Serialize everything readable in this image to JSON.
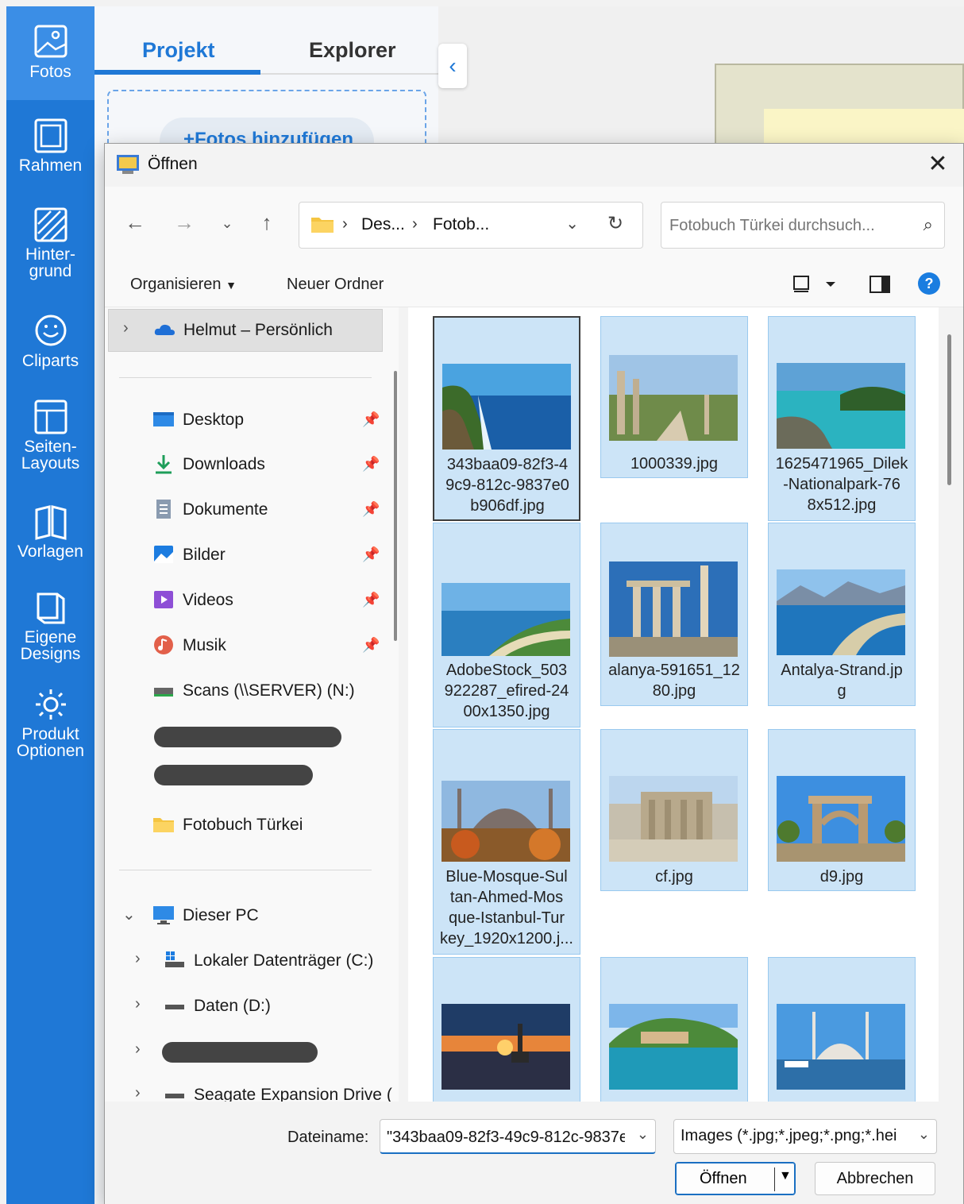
{
  "app": {
    "sidebar": {
      "items": [
        {
          "label": "Fotos",
          "icon": "photos-icon"
        },
        {
          "label": "Rahmen",
          "icon": "frame-icon"
        },
        {
          "label": "Hinter-",
          "label2": "grund",
          "icon": "background-icon"
        },
        {
          "label": "Cliparts",
          "icon": "clipart-icon"
        },
        {
          "label": "Seiten-",
          "label2": "Layouts",
          "icon": "layout-icon"
        },
        {
          "label": "Vorlagen",
          "icon": "templates-icon"
        },
        {
          "label": "Eigene",
          "label2": "Designs",
          "icon": "designs-icon"
        },
        {
          "label": "Produkt",
          "label2": "Optionen",
          "icon": "gear-icon"
        }
      ]
    },
    "tabs": {
      "projekt": "Projekt",
      "explorer": "Explorer"
    },
    "add_photos": "Fotos hinzufügen"
  },
  "dialog": {
    "title": "Öffnen",
    "address": {
      "crumb1": "Des...",
      "crumb2": "Fotob..."
    },
    "search": {
      "placeholder": "Fotobuch Türkei durchsuch..."
    },
    "commands": {
      "organize": "Organisieren",
      "new_folder": "Neuer Ordner"
    },
    "nav": {
      "onedrive": "Helmut – Persönlich",
      "quick": [
        {
          "label": "Desktop",
          "icon": "desktop-icon"
        },
        {
          "label": "Downloads",
          "icon": "download-icon"
        },
        {
          "label": "Dokumente",
          "icon": "documents-icon"
        },
        {
          "label": "Bilder",
          "icon": "pictures-icon"
        },
        {
          "label": "Videos",
          "icon": "videos-icon"
        },
        {
          "label": "Musik",
          "icon": "music-icon"
        },
        {
          "label": "Scans (\\\\SERVER) (N:)",
          "icon": "network-drive-icon"
        }
      ],
      "fotobuch": "Fotobuch Türkei",
      "this_pc": "Dieser PC",
      "drives": [
        "Lokaler Datenträger (C:)",
        "Daten (D:)",
        "Seagate Expansion Drive ("
      ]
    },
    "files": [
      {
        "name": "343baa09-82f3-49c9-812c-9837e0b906df.jpg",
        "lines": [
          "343baa09-82f3-4",
          "9c9-812c-9837e0",
          "b906df.jpg"
        ]
      },
      {
        "name": "1000339.jpg",
        "lines": [
          "1000339.jpg"
        ]
      },
      {
        "name": "1625471965_Dilek-Nationalpark-768x512.jpg",
        "lines": [
          "1625471965_Dilek",
          "-Nationalpark-76",
          "8x512.jpg"
        ]
      },
      {
        "name": "AdobeStock_503922287_efired-2400x1350.jpg",
        "lines": [
          "AdobeStock_503",
          "922287_efired-24",
          "00x1350.jpg"
        ]
      },
      {
        "name": "alanya-591651_1280.jpg",
        "lines": [
          "alanya-591651_12",
          "80.jpg"
        ]
      },
      {
        "name": "Antalya-Strand.jpg",
        "lines": [
          "Antalya-Strand.jp",
          "g"
        ]
      },
      {
        "name": "Blue-Mosque-Sultan-Ahmed-Mosque-Istanbul-Turkey_1920x1200.j...",
        "lines": [
          "Blue-Mosque-Sul",
          "tan-Ahmed-Mos",
          "que-Istanbul-Tur",
          "key_1920x1200.j..."
        ]
      },
      {
        "name": "cf.jpg",
        "lines": [
          "cf.jpg"
        ]
      },
      {
        "name": "d9.jpg",
        "lines": [
          "d9.jpg"
        ]
      }
    ],
    "filename_label": "Dateiname:",
    "filename_value": "\"343baa09-82f3-49c9-812c-9837e",
    "filetype": "Images (*.jpg;*.jpeg;*.png;*.hei",
    "open_button": "Öffnen",
    "cancel_button": "Abbrechen",
    "colors": {
      "accent": "#1f78d6",
      "selection": "#cce4f7",
      "selection_border": "#99c9ef"
    }
  }
}
